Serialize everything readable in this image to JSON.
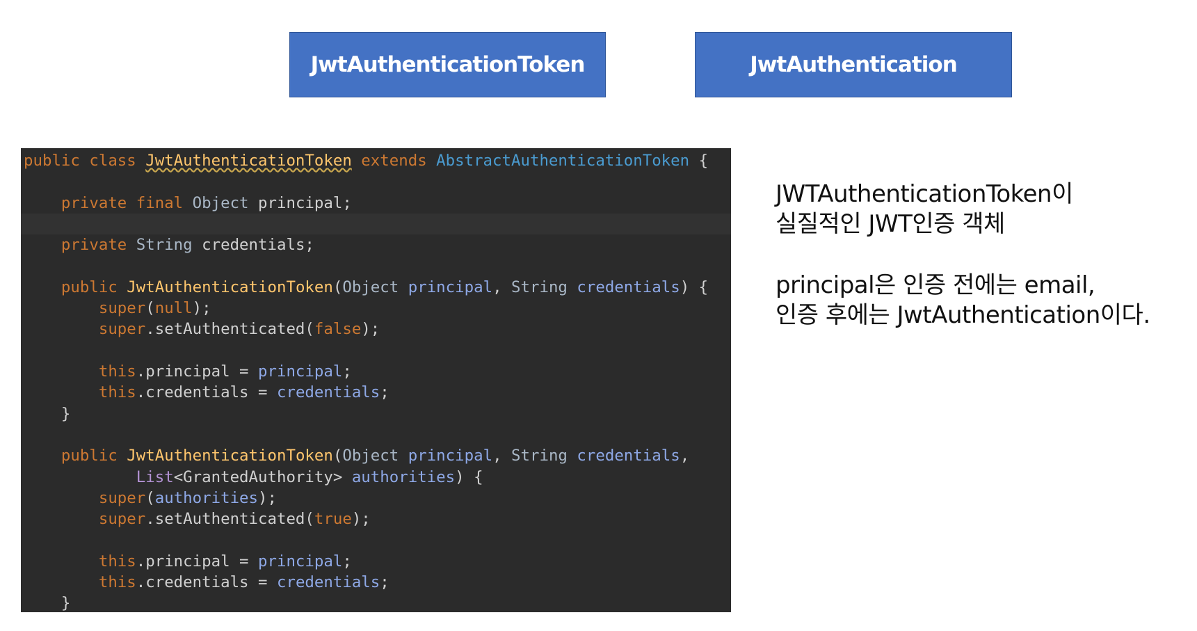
{
  "boxes": [
    {
      "label": "JwtAuthenticationToken"
    },
    {
      "label": "JwtAuthentication"
    }
  ],
  "code_lines": [
    [
      [
        "kw",
        "public class "
      ],
      [
        "decl-wavy",
        "JwtAuthenticationToken"
      ],
      [
        "kw",
        " extends "
      ],
      [
        "ext",
        "AbstractAuthenticationToken"
      ],
      [
        "pl",
        " {"
      ]
    ],
    [],
    [
      [
        "pl",
        "    "
      ],
      [
        "kw",
        "private final "
      ],
      [
        "type",
        "Object "
      ],
      [
        "pl",
        "principal;"
      ]
    ],
    [],
    [
      [
        "pl",
        "    "
      ],
      [
        "kw",
        "private "
      ],
      [
        "type",
        "String "
      ],
      [
        "pl",
        "credentials;"
      ]
    ],
    [],
    [
      [
        "pl",
        "    "
      ],
      [
        "kw",
        "public "
      ],
      [
        "decl",
        "JwtAuthenticationToken"
      ],
      [
        "pl",
        "("
      ],
      [
        "type",
        "Object "
      ],
      [
        "par",
        "principal"
      ],
      [
        "pl",
        ", "
      ],
      [
        "type",
        "String "
      ],
      [
        "par",
        "credentials"
      ],
      [
        "pl",
        ") {"
      ]
    ],
    [
      [
        "pl",
        "        "
      ],
      [
        "kw",
        "super"
      ],
      [
        "pl",
        "("
      ],
      [
        "kw",
        "null"
      ],
      [
        "pl",
        ");"
      ]
    ],
    [
      [
        "pl",
        "        "
      ],
      [
        "kw",
        "super"
      ],
      [
        "pl",
        ".setAuthenticated("
      ],
      [
        "kw",
        "false"
      ],
      [
        "pl",
        ");"
      ]
    ],
    [],
    [
      [
        "pl",
        "        "
      ],
      [
        "kw",
        "this"
      ],
      [
        "pl",
        ".principal = "
      ],
      [
        "par",
        "principal"
      ],
      [
        "pl",
        ";"
      ]
    ],
    [
      [
        "pl",
        "        "
      ],
      [
        "kw",
        "this"
      ],
      [
        "pl",
        ".credentials = "
      ],
      [
        "par",
        "credentials"
      ],
      [
        "pl",
        ";"
      ]
    ],
    [
      [
        "pl",
        "    }"
      ]
    ],
    [],
    [
      [
        "pl",
        "    "
      ],
      [
        "kw",
        "public "
      ],
      [
        "decl",
        "JwtAuthenticationToken"
      ],
      [
        "pl",
        "("
      ],
      [
        "type",
        "Object "
      ],
      [
        "par",
        "principal"
      ],
      [
        "pl",
        ", "
      ],
      [
        "type",
        "String "
      ],
      [
        "par",
        "credentials"
      ],
      [
        "pl",
        ","
      ]
    ],
    [
      [
        "pl",
        "            "
      ],
      [
        "gen",
        "List"
      ],
      [
        "pl",
        "<GrantedAuthority> "
      ],
      [
        "par",
        "authorities"
      ],
      [
        "pl",
        ") {"
      ]
    ],
    [
      [
        "pl",
        "        "
      ],
      [
        "kw",
        "super"
      ],
      [
        "pl",
        "("
      ],
      [
        "par",
        "authorities"
      ],
      [
        "pl",
        ");"
      ]
    ],
    [
      [
        "pl",
        "        "
      ],
      [
        "kw",
        "super"
      ],
      [
        "pl",
        ".setAuthenticated("
      ],
      [
        "kw",
        "true"
      ],
      [
        "pl",
        ");"
      ]
    ],
    [],
    [
      [
        "pl",
        "        "
      ],
      [
        "kw",
        "this"
      ],
      [
        "pl",
        ".principal = "
      ],
      [
        "par",
        "principal"
      ],
      [
        "pl",
        ";"
      ]
    ],
    [
      [
        "pl",
        "        "
      ],
      [
        "kw",
        "this"
      ],
      [
        "pl",
        ".credentials = "
      ],
      [
        "par",
        "credentials"
      ],
      [
        "pl",
        ";"
      ]
    ],
    [
      [
        "pl",
        "    }"
      ]
    ]
  ],
  "description": {
    "block1": [
      "JWTAuthenticationToken이",
      "실질적인 JWT인증 객체"
    ],
    "block2": [
      "principal은 인증 전에는 email,",
      "인증 후에는 JwtAuthentication이다."
    ]
  },
  "colors": {
    "box_fill": "#4472c4",
    "code_background": "#2b2b2b",
    "keyword": "#cc7832",
    "method_name": "#ffc66d",
    "parameter": "#8ea8e6",
    "superclass": "#4a9bd0"
  }
}
